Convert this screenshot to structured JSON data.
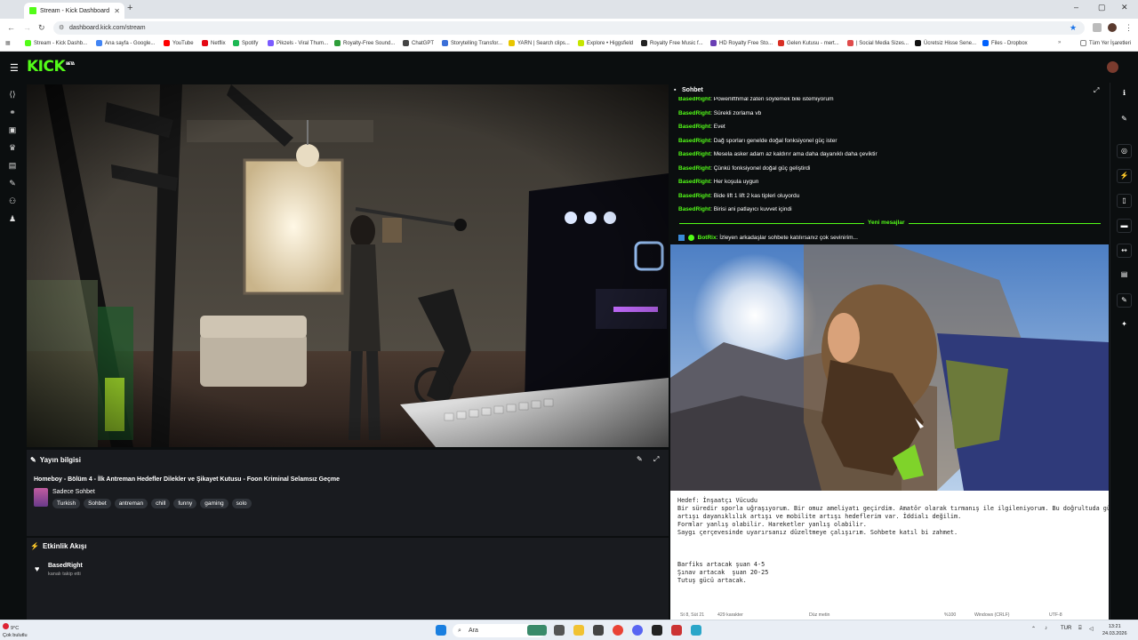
{
  "browser": {
    "tab_title": "Stream - Kick Dashboard",
    "url": "dashboard.kick.com/stream",
    "bookmarks": [
      {
        "label": "Stream - Kick Dashb...",
        "color": "#53fc18"
      },
      {
        "label": "Ana sayfa - Google...",
        "color": "#4285f4"
      },
      {
        "label": "YouTube",
        "color": "#ff0000"
      },
      {
        "label": "Netflix",
        "color": "#e50914"
      },
      {
        "label": "Spotify",
        "color": "#1db954"
      },
      {
        "label": "Pikzels - Viral Thum...",
        "color": "#7b5cff"
      },
      {
        "label": "Royalty-Free Sound...",
        "color": "#2e9e3a"
      },
      {
        "label": "ChatGPT",
        "color": "#444444"
      },
      {
        "label": "Storytelling Transfor...",
        "color": "#3b6fd8"
      },
      {
        "label": "YARN | Search clips...",
        "color": "#e8c600"
      },
      {
        "label": "Explore • Higgsfield",
        "color": "#c6e600"
      },
      {
        "label": "Royalty Free Music f...",
        "color": "#222222"
      },
      {
        "label": "HD Royalty Free Sto...",
        "color": "#6a3fb5"
      },
      {
        "label": "Gelen Kutusu - mert...",
        "color": "#d93025"
      },
      {
        "label": "| Social Media Sizes...",
        "color": "#e04b4b"
      },
      {
        "label": "Ücretsiz Hisse Sene...",
        "color": "#111111"
      },
      {
        "label": "Files - Dropbox",
        "color": "#0061fe"
      }
    ],
    "all_bookmarks_label": "Tüm Yer İşaretleri"
  },
  "kick": {
    "logo": "KICK",
    "logo_badge": "BETA"
  },
  "stream_info": {
    "panel_title": "Yayın bilgisi",
    "title": "Homeboy - Bölüm 4 - İlk Antreman Hedefler Dilekler ve Şikayet Kutusu - Foon Kriminal Selamsız Geçme",
    "category": "Sadece Sohbet",
    "tags": [
      "Turkish",
      "Sohbet",
      "antreman",
      "chill",
      "funny",
      "gaming",
      "solo"
    ]
  },
  "activity": {
    "panel_title": "Etkinlik Akışı",
    "items": [
      {
        "user": "BasedRight",
        "action": "kanalı takip etti"
      }
    ]
  },
  "chat": {
    "title": "Sohbet",
    "messages": [
      {
        "user": "BasedRight",
        "text": ": Powerlifthmal zaten söylemek bile istemiyorum"
      },
      {
        "user": "BasedRight",
        "text": ": Sürekli zorlama vb"
      },
      {
        "user": "BasedRight",
        "text": ": Evet"
      },
      {
        "user": "BasedRight",
        "text": ": Dağ sporları genelde doğal fonksiyonel güç ister"
      },
      {
        "user": "BasedRight",
        "text": ": Mesela asker adam az kaldırır ama daha dayanıklı daha çeviktir"
      },
      {
        "user": "BasedRight",
        "text": ": Çünkü fonksiyonel doğal güç geliştirdi"
      },
      {
        "user": "BasedRight",
        "text": ": Her koşula uygun"
      },
      {
        "user": "BasedRight",
        "text": ": Bide lift 1 lift 2 kas tipleri oluyordu"
      },
      {
        "user": "BasedRight",
        "text": ": Birisi ani patlayıcı kuvvet içindi"
      }
    ],
    "new_messages_label": "Yeni mesajlar",
    "bot": {
      "user": "BotRix",
      "text": ": İzleyen arkadaşlar sohbete katılırsanız çok sevinirim..."
    }
  },
  "notepad": {
    "lines": [
      "Hedef: İnşaatçı Vücudu",
      "Bir süredir sporla uğraşıyorum. Bir omuz ameliyatı geçirdim. Amatör olarak tırmanış ile ilgileniyorum. Bu doğrultuda güç",
      "artışı dayanıklılık artışı ve mobilite artışı hedeflerim var. İddialı değilim.",
      "Formlar yanlış olabilir. Hareketler yanlış olabilir.",
      "Saygı çerçevesinde uyarırsanız düzeltmeye çalışırım. Sohbete katıl bi zahmet.",
      "",
      "",
      "",
      "Barfiks artacak şuan 4-5",
      "Şınav artacak  şuan 20-25",
      "Tutuş gücü artacak."
    ],
    "status": {
      "position": "St 8, Süt 21",
      "chars": "429 karakter",
      "format": "Düz metin",
      "zoom": "%100",
      "eol": "Windows (CRLF)",
      "encoding": "UTF-8"
    }
  },
  "taskbar": {
    "weather_temp": "9°C",
    "weather_desc": "Çok bulutlu",
    "search_placeholder": "Ara",
    "lang": "TUR",
    "time": "13:21",
    "date": "24.03.2026"
  }
}
